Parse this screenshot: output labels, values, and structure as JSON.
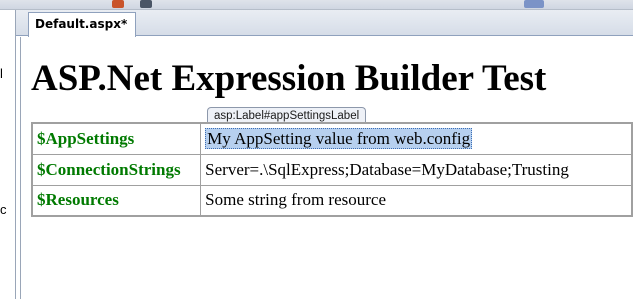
{
  "toolbar": {
    "icons": [
      "toolbar-icon-1",
      "toolbar-icon-2",
      "toolbar-icon-3"
    ]
  },
  "left_panel": {
    "fragments": [
      "l",
      "c"
    ]
  },
  "tabs": [
    {
      "label": "Default.aspx*",
      "active": true
    }
  ],
  "page": {
    "heading": "ASP.Net Expression Builder Test",
    "selected_tag": "asp:Label#appSettingsLabel",
    "rows": [
      {
        "key": "$AppSettings",
        "value": "My AppSetting value from web.config",
        "selected": true
      },
      {
        "key": "$ConnectionStrings",
        "value": "Server=.\\SqlExpress;Database=MyDatabase;Trusting"
      },
      {
        "key": "$Resources",
        "value": "Some string from resource"
      }
    ]
  },
  "colors": {
    "key_text": "#007a00",
    "selection_bg": "#b7d0ef",
    "tab_border": "#8fa1bd"
  }
}
